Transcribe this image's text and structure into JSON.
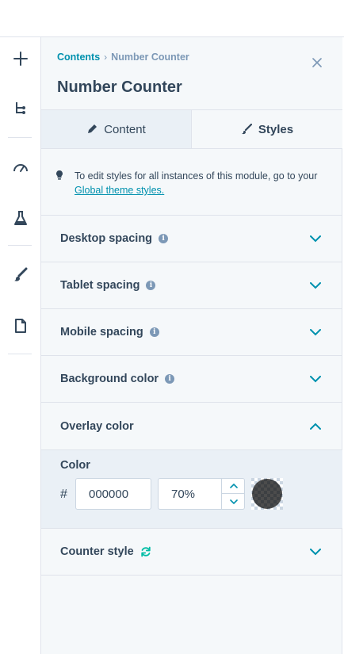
{
  "rail": {
    "items": [
      {
        "name": "add-icon"
      },
      {
        "name": "tree-icon"
      },
      {
        "name": "gauge-icon"
      },
      {
        "name": "flask-icon"
      },
      {
        "name": "brush-icon"
      },
      {
        "name": "page-icon"
      }
    ]
  },
  "panel": {
    "breadcrumb": {
      "parent": "Contents",
      "separator": "›",
      "current": "Number Counter"
    },
    "title": "Number Counter",
    "tabs": [
      {
        "label": "Content",
        "icon": "pencil-icon",
        "active": false
      },
      {
        "label": "Styles",
        "icon": "brush-icon",
        "active": true
      }
    ],
    "note": {
      "text": "To edit styles for all instances of this module, go to your ",
      "link": "Global theme styles."
    },
    "sections": [
      {
        "label": "Desktop spacing",
        "info": true,
        "expanded": false
      },
      {
        "label": "Tablet spacing",
        "info": true,
        "expanded": false
      },
      {
        "label": "Mobile spacing",
        "info": true,
        "expanded": false
      },
      {
        "label": "Background color",
        "info": true,
        "expanded": false
      },
      {
        "label": "Overlay color",
        "info": false,
        "expanded": true
      }
    ],
    "overlay": {
      "color_label": "Color",
      "hash": "#",
      "hex_value": "000000",
      "opacity_value": "70%",
      "swatch_color": "#000000",
      "swatch_opacity": 0.7
    },
    "counter_section": {
      "label": "Counter style",
      "icon": "refresh-icon",
      "expanded": false
    }
  },
  "colors": {
    "accent": "#0091ae",
    "text": "#33475b",
    "muted": "#7c98b6",
    "panel_bg": "#f5f8fa",
    "active_bg": "#eaf0f6",
    "border": "#dfe3eb"
  }
}
